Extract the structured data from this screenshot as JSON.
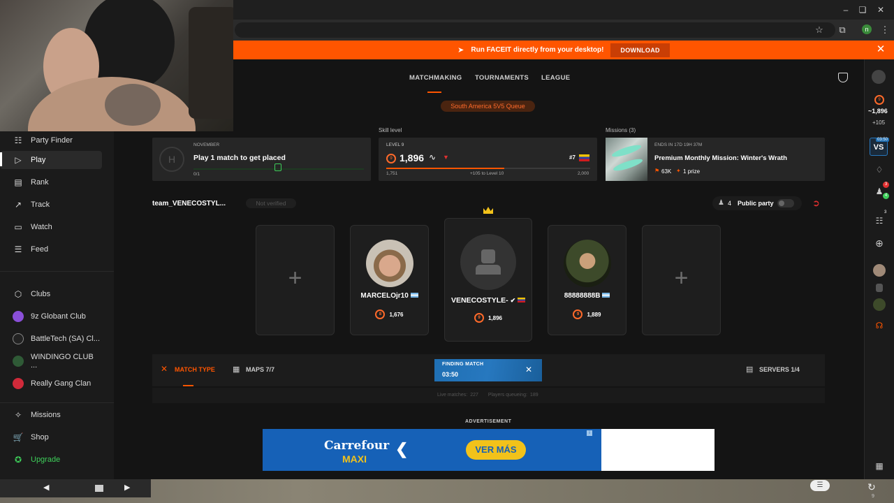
{
  "promo": {
    "text": "Run FACEIT directly from your desktop!",
    "download": "DOWNLOAD"
  },
  "tabs": {
    "matchmaking": "MATCHMAKING",
    "tournaments": "TOURNAMENTS",
    "league": "LEAGUE"
  },
  "queue": "South America 5V5 Queue",
  "sidebar": {
    "items": [
      "Party Finder",
      "Play",
      "Rank",
      "Track",
      "Watch",
      "Feed"
    ],
    "clubs_label": "Clubs",
    "clubs": [
      "9z Globant Club",
      "BattleTech (SA) Cl...",
      "WINDINGO CLUB ...",
      "Really Gang Clan"
    ],
    "bottom": [
      "Missions",
      "Shop",
      "Upgrade"
    ]
  },
  "ladder": {
    "month": "NOVEMBER",
    "title": "Play 1 match to get placed",
    "progress": "0/1"
  },
  "skill": {
    "label": "Skill level",
    "level": "LEVEL 9",
    "elo": "1,896",
    "rank": "#7",
    "min": "1,751",
    "mid": "+105 to Level 10",
    "max": "2,000",
    "progress": 0.58
  },
  "missions": {
    "label": "Missions (3)",
    "ends": "ENDS IN 17D 19H 37M",
    "title": "Premium Monthly Mission: Winter's Wrath",
    "points": "63K",
    "prize": "1 prize"
  },
  "party": {
    "team": "team_VENECOSTYL...",
    "verified": "Not verified",
    "count": "4",
    "public": "Public party",
    "members": [
      {
        "name": "MARCELOjr10",
        "elo": "1,676",
        "level": "8"
      },
      {
        "name": "VENECOSTYLE-",
        "elo": "1,896",
        "level": "9"
      },
      {
        "name": "88888888B",
        "elo": "1,889",
        "level": "9"
      }
    ]
  },
  "matchbar": {
    "match_type": "MATCH TYPE",
    "maps": "MAPS 7/7",
    "finding": "FINDING MATCH",
    "timer": "03:50",
    "servers": "SERVERS 1/4",
    "live_label": "Live matches:",
    "live": "227",
    "queue_label": "Players queueing:",
    "queue": "189"
  },
  "ad": {
    "label": "ADVERTISEMENT",
    "brand": "Carrefour",
    "sub": "MAXI",
    "cta": "VER MÁS"
  },
  "rail": {
    "elo": "~1,896",
    "plus": "+105",
    "vs_timer": "03:50",
    "badge1": "3",
    "badge2": "4",
    "badge3": "3",
    "history": "9"
  },
  "colors": {
    "accent": "#ff5500",
    "finding": "#1f6fb3",
    "bg": "#141414"
  }
}
